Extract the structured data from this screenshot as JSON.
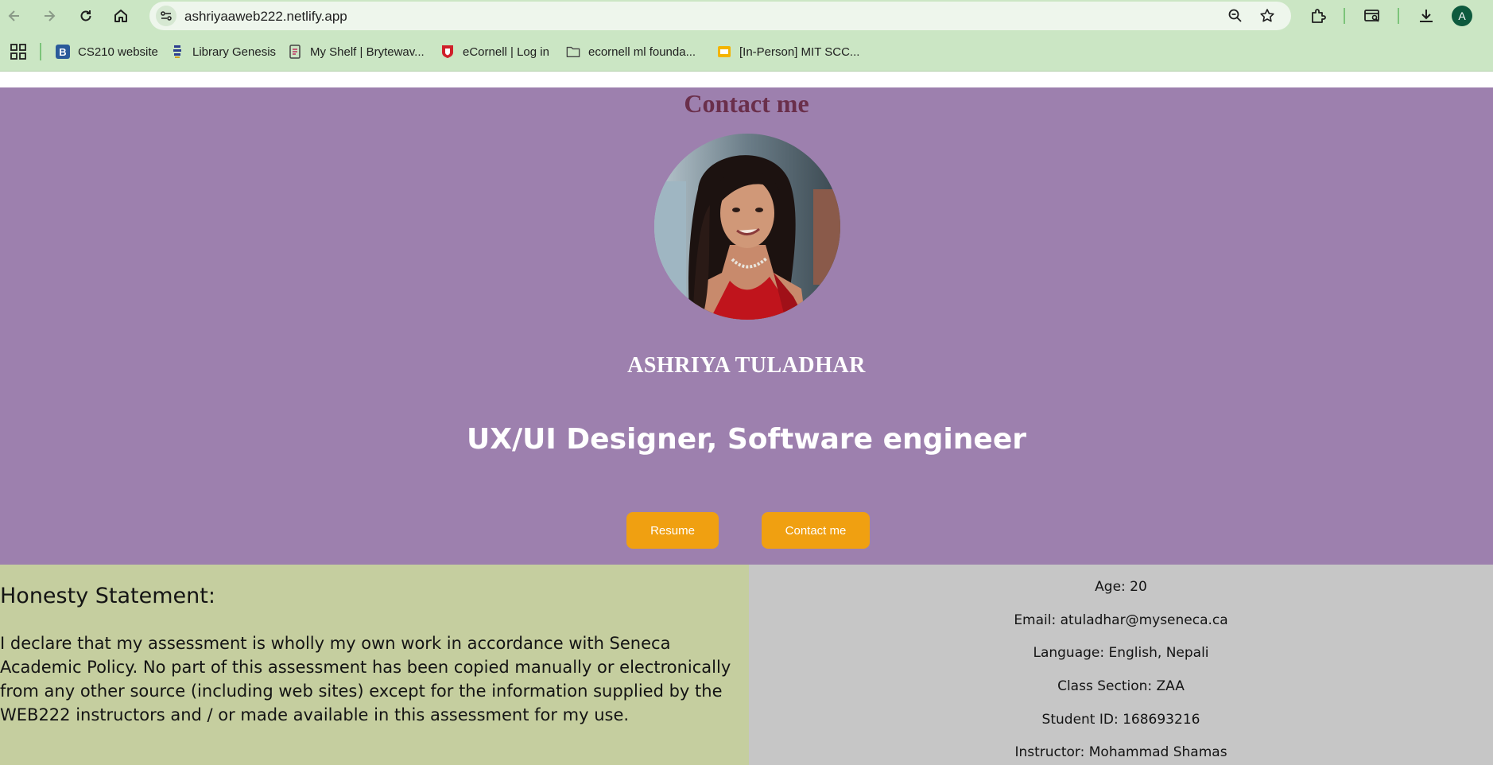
{
  "browser": {
    "url": "ashriyaaweb222.netlify.app",
    "profile_initial": "A",
    "icons": [
      "back-icon",
      "forward-icon",
      "reload-icon",
      "home-icon",
      "site-info-icon",
      "zoom-icon",
      "star-icon",
      "extensions-icon",
      "tab-search-icon",
      "download-icon"
    ]
  },
  "bookmarks": [
    {
      "label": "CS210 website"
    },
    {
      "label": "Library Genesis"
    },
    {
      "label": "My Shelf | Brytewav..."
    },
    {
      "label": "eCornell | Log in"
    },
    {
      "label": "ecornell ml founda..."
    },
    {
      "label": "[In-Person] MIT SCC..."
    }
  ],
  "hero": {
    "section_title": "Contact me",
    "name": "ASHRIYA TULADHAR",
    "role": "UX/UI Designer, Software engineer",
    "resume_button": "Resume",
    "contact_button": "Contact me",
    "background_color": "#9d80ae",
    "button_color": "#f0a011"
  },
  "honesty": {
    "title": "Honesty Statement:",
    "text": "I declare that my assessment is wholly my own work in accordance with Seneca Academic Policy. No part of this assessment has been copied manually or electronically from any other source (including web sites) except for the information supplied by the WEB222 instructors and / or made available in this assessment for my use."
  },
  "info": {
    "age": "Age: 20",
    "email": "Email: atuladhar@myseneca.ca",
    "language": "Language: English, Nepali",
    "class_section": "Class Section: ZAA",
    "student_id": "Student ID: 168693216",
    "instructor": "Instructor: Mohammad Shamas"
  }
}
